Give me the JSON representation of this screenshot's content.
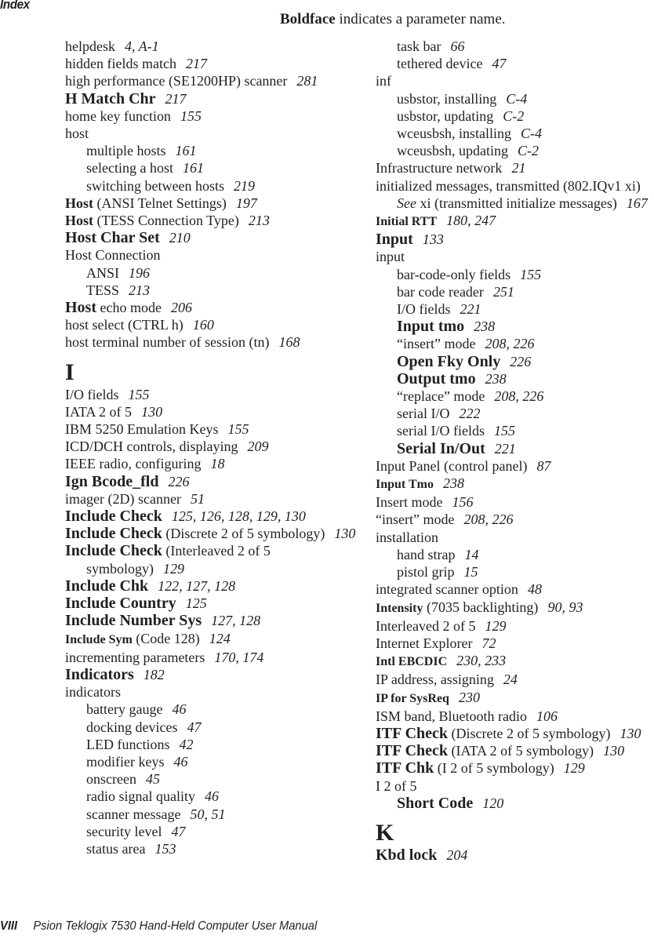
{
  "header": {
    "section_title": "Index",
    "note_bold": "Boldface",
    "note_rest": " indicates a parameter name."
  },
  "left_column": [
    {
      "text": "helpdesk",
      "pages": "4, A-1"
    },
    {
      "text": "hidden fields match",
      "pages": "217"
    },
    {
      "text": "high performance (SE1200HP) scanner",
      "pages": "281",
      "wrap": true
    },
    {
      "bold": "H Match Chr",
      "pages": "217",
      "big": true
    },
    {
      "text": "home key function",
      "pages": "155"
    },
    {
      "text": "host"
    },
    {
      "text": "multiple hosts",
      "pages": "161",
      "sub": true
    },
    {
      "text": "selecting a host",
      "pages": "161",
      "sub": true
    },
    {
      "text": "switching between hosts",
      "pages": "219",
      "sub": true
    },
    {
      "bold": "Host",
      "text": " (ANSI Telnet Settings)",
      "pages": "197"
    },
    {
      "bold": "Host",
      "text": " (TESS Connection Type)",
      "pages": "213"
    },
    {
      "bold": "Host Char Set",
      "pages": "210",
      "big": true
    },
    {
      "text": "Host Connection"
    },
    {
      "text": "ANSI",
      "pages": "196",
      "sub": true
    },
    {
      "text": "TESS",
      "pages": "213",
      "sub": true
    },
    {
      "bold": "Host",
      "text": " echo mode",
      "pages": "206",
      "big": true
    },
    {
      "text": "host select (CTRL h)",
      "pages": "160"
    },
    {
      "text": "host terminal number of session (tn)",
      "pages": "168"
    },
    {
      "letter": "I"
    },
    {
      "text": "I/O fields",
      "pages": "155"
    },
    {
      "text": "IATA 2 of 5",
      "pages": "130"
    },
    {
      "text": "IBM 5250 Emulation Keys",
      "pages": "155"
    },
    {
      "text": "ICD/DCH controls, displaying",
      "pages": "209"
    },
    {
      "text": "IEEE radio, configuring",
      "pages": "18"
    },
    {
      "bold": "Ign Bcode_fld",
      "pages": "226",
      "big": true
    },
    {
      "text": "imager (2D) scanner",
      "pages": "51"
    },
    {
      "bold": "Include Check",
      "pages": "125, 126, 128, 129, 130",
      "big": true
    },
    {
      "bold": "Include Check",
      "text": " (Discrete 2 of 5 symbology)",
      "pages": "130",
      "big": true,
      "wrap": true
    },
    {
      "bold": "Include Check",
      "text": " (Interleaved 2 of 5 symbology)",
      "pages": "129",
      "big": true,
      "wrap": true
    },
    {
      "bold": "Include Chk",
      "pages": "122, 127, 128",
      "big": true
    },
    {
      "bold": "Include Country",
      "pages": "125",
      "big": true
    },
    {
      "bold": "Include Number Sys",
      "pages": "127, 128",
      "big": true
    },
    {
      "bold": "Include Sym",
      "text": " (Code 128)",
      "pages": "124",
      "small": true
    },
    {
      "text": "incrementing parameters",
      "pages": "170, 174"
    },
    {
      "bold": "Indicators",
      "pages": "182",
      "big": true
    },
    {
      "text": "indicators"
    },
    {
      "text": "battery gauge",
      "pages": "46",
      "sub": true
    },
    {
      "text": "docking devices",
      "pages": "47",
      "sub": true
    },
    {
      "text": "LED functions",
      "pages": "42",
      "sub": true
    },
    {
      "text": "modifier keys",
      "pages": "46",
      "sub": true
    },
    {
      "text": "onscreen",
      "pages": "45",
      "sub": true
    },
    {
      "text": "radio signal quality",
      "pages": "46",
      "sub": true
    },
    {
      "text": "scanner message",
      "pages": "50, 51",
      "sub": true
    },
    {
      "text": "security level",
      "pages": "47",
      "sub": true
    },
    {
      "text": "status area",
      "pages": "153",
      "sub": true
    }
  ],
  "right_column": [
    {
      "text": "task bar",
      "pages": "66",
      "sub": true
    },
    {
      "text": "tethered device",
      "pages": "47",
      "sub": true
    },
    {
      "text": "inf"
    },
    {
      "text": "usbstor, installing",
      "pages": "C-4",
      "sub": true
    },
    {
      "text": "usbstor, updating",
      "pages": "C-2",
      "sub": true
    },
    {
      "text": "wceusbsh, installing",
      "pages": "C-4",
      "sub": true
    },
    {
      "text": "wceusbsh, updating",
      "pages": "C-2",
      "sub": true
    },
    {
      "text": "Infrastructure network",
      "pages": "21"
    },
    {
      "text": "initialized messages, transmitted (802.IQv1 xi)",
      "see": "See",
      "see_target": " xi (transmitted initialize messages)",
      "pages": "167",
      "wrap": true
    },
    {
      "bold": "Initial RTT",
      "pages": "180, 247",
      "small": true
    },
    {
      "bold": "Input",
      "pages": "133",
      "big": true
    },
    {
      "text": "input"
    },
    {
      "text": "bar-code-only fields",
      "pages": "155",
      "sub": true
    },
    {
      "text": "bar code reader",
      "pages": "251",
      "sub": true
    },
    {
      "text": "I/O fields",
      "pages": "221",
      "sub": true
    },
    {
      "bold": "Input tmo",
      "pages": "238",
      "sub": true,
      "big": true
    },
    {
      "text": "“insert” mode",
      "pages": "208, 226",
      "sub": true
    },
    {
      "bold": "Open Fky Only",
      "pages": "226",
      "sub": true,
      "big": true
    },
    {
      "bold": "Output tmo",
      "pages": "238",
      "sub": true,
      "big": true
    },
    {
      "text": "“replace” mode",
      "pages": "208, 226",
      "sub": true
    },
    {
      "text": "serial I/O",
      "pages": "222",
      "sub": true
    },
    {
      "text": "serial I/O fields",
      "pages": "155",
      "sub": true
    },
    {
      "bold": "Serial In/Out",
      "pages": "221",
      "sub": true,
      "big": true
    },
    {
      "text": "Input Panel (control panel)",
      "pages": "87"
    },
    {
      "bold": "Input Tmo",
      "pages": "238",
      "small": true
    },
    {
      "text": "Insert mode",
      "pages": "156"
    },
    {
      "text": "“insert” mode",
      "pages": "208, 226"
    },
    {
      "text": "installation"
    },
    {
      "text": "hand strap",
      "pages": "14",
      "sub": true
    },
    {
      "text": "pistol grip",
      "pages": "15",
      "sub": true
    },
    {
      "text": "integrated scanner option",
      "pages": "48"
    },
    {
      "bold": "Intensity",
      "text": " (7035 backlighting)",
      "pages": "90, 93",
      "small": true
    },
    {
      "text": "Interleaved 2 of 5",
      "pages": "129"
    },
    {
      "text": "Internet Explorer",
      "pages": "72"
    },
    {
      "bold": "Intl EBCDIC",
      "pages": "230, 233",
      "small": true
    },
    {
      "text": "IP address, assigning",
      "pages": "24"
    },
    {
      "bold": "IP for SysReq",
      "pages": "230",
      "small": true
    },
    {
      "text": "ISM band, Bluetooth radio",
      "pages": "106"
    },
    {
      "bold": "ITF Check",
      "text": " (Discrete 2 of 5 symbology)",
      "pages": "130",
      "big": true,
      "wrap": true
    },
    {
      "bold": "ITF Check",
      "text": " (IATA 2 of 5 symbology)",
      "pages": "130",
      "big": true
    },
    {
      "bold": "ITF Chk",
      "text": " (I 2 of 5 symbology)",
      "pages": "129",
      "big": true
    },
    {
      "text": "I 2 of 5"
    },
    {
      "bold": "Short Code",
      "pages": "120",
      "sub": true,
      "big": true
    },
    {
      "letter": "K"
    },
    {
      "bold": "Kbd lock",
      "pages": "204",
      "big": true
    }
  ],
  "footer": {
    "page_number": "VIII",
    "manual_title": "Psion Teklogix 7530 Hand-Held Computer User Manual"
  }
}
